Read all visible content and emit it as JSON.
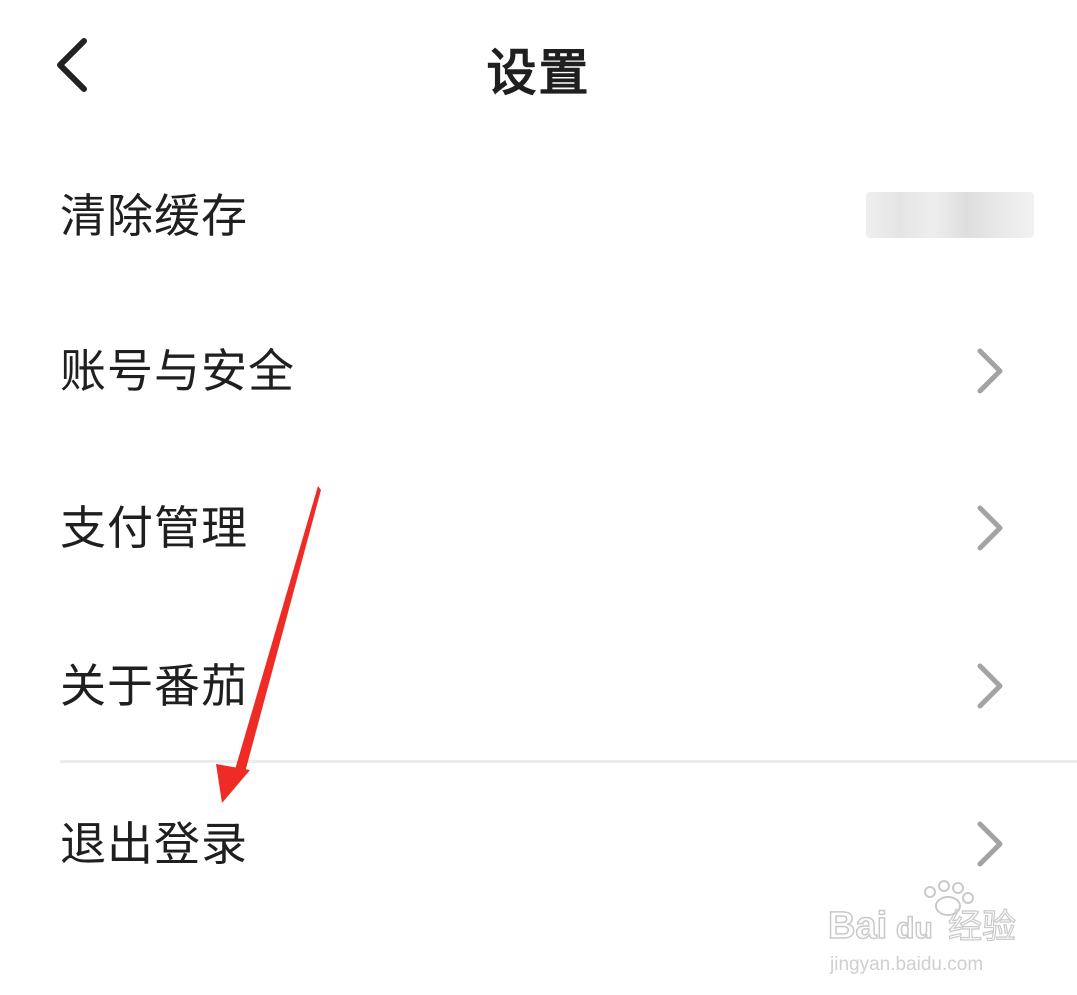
{
  "header": {
    "title": "设置",
    "back_icon": "chevron-left-icon"
  },
  "menu": {
    "items": [
      {
        "label": "清除缓存",
        "value": "",
        "value_obscured": true
      },
      {
        "label": "账号与安全",
        "icon": "chevron-right-icon"
      },
      {
        "label": "支付管理",
        "icon": "chevron-right-icon"
      },
      {
        "label": "关于番茄",
        "icon": "chevron-right-icon"
      },
      {
        "label": "退出登录",
        "icon": "chevron-right-icon"
      }
    ]
  },
  "annotation": {
    "arrow_color": "#ee2b24",
    "points_to": "退出登录"
  },
  "watermark": {
    "brand": "Baidu",
    "text": "经验",
    "url": "jingyan.baidu.com"
  },
  "colors": {
    "text": "#1f1f1f",
    "chevron": "#a3a3a3",
    "divider": "#ececec",
    "background": "#ffffff"
  }
}
